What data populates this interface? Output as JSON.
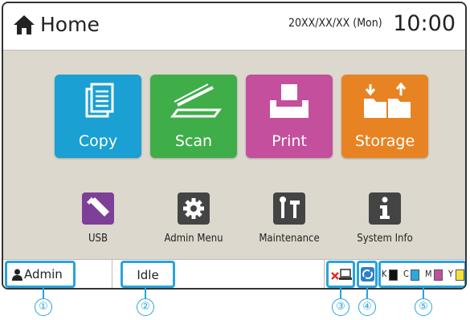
{
  "header": {
    "title": "Home",
    "date": "20XX/XX/XX (Mon)",
    "time": "10:00"
  },
  "main_tiles": [
    {
      "label": "Copy",
      "color": "#1aa0d2",
      "icon": "copy-icon"
    },
    {
      "label": "Scan",
      "color": "#3fae49",
      "icon": "scan-icon"
    },
    {
      "label": "Print",
      "color": "#c44f9d",
      "icon": "print-icon"
    },
    {
      "label": "Storage",
      "color": "#e88323",
      "icon": "storage-icon"
    }
  ],
  "small_tiles": [
    {
      "label": "USB",
      "color": "#7d3f98",
      "icon": "usb-icon"
    },
    {
      "label": "Admin Menu",
      "color": "#444444",
      "icon": "gear-icon"
    },
    {
      "label": "Maintenance",
      "color": "#444444",
      "icon": "tools-icon"
    },
    {
      "label": "System Info",
      "color": "#444444",
      "icon": "info-icon"
    }
  ],
  "status": {
    "user": "Admin",
    "state": "Idle",
    "ink": [
      {
        "name": "K",
        "color": "#111111"
      },
      {
        "name": "C",
        "color": "#2aa8e0"
      },
      {
        "name": "M",
        "color": "#c04fa0"
      },
      {
        "name": "Y",
        "color": "#f4e23a"
      }
    ]
  },
  "callouts": [
    "①",
    "②",
    "③",
    "④",
    "⑤"
  ],
  "accent": "#29a3dc"
}
